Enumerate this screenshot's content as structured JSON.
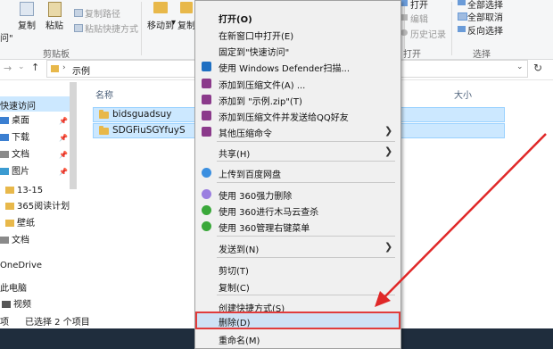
{
  "ribbon": {
    "copy_path": "复制路径",
    "paste_shortcut": "粘贴快捷方式",
    "copy": "复制",
    "paste": "粘贴",
    "left_fragment": "问\"",
    "clipboard_group": "剪贴板",
    "move_to": "移动到",
    "copy_to_frag": "复制",
    "open": "打开",
    "edit": "编辑",
    "history": "历史记录",
    "open_group": "打开",
    "select_all": "全部选择",
    "select_none": "全部取消",
    "invert": "反向选择",
    "select_group": "选择"
  },
  "address": {
    "path": "示例"
  },
  "columns": {
    "name": "名称",
    "size": "大小"
  },
  "nav": {
    "quick_access": "快速访问",
    "items": [
      {
        "label": "桌面",
        "pinned": true
      },
      {
        "label": "下载",
        "pinned": true
      },
      {
        "label": "文档",
        "pinned": true
      },
      {
        "label": "图片",
        "pinned": true
      },
      {
        "label": "13-15",
        "pinned": false
      },
      {
        "label": "365阅读计划",
        "pinned": false
      },
      {
        "label": "壁纸",
        "pinned": false
      },
      {
        "label": "文档",
        "pinned": false
      }
    ],
    "onedrive": "OneDrive",
    "this_pc": "此电脑",
    "videos": "视频",
    "pin_glyph": "📌"
  },
  "files": [
    {
      "name": "bidsguadsuy"
    },
    {
      "name": "SDGFiuSGYfuyS"
    }
  ],
  "status": {
    "count": "项",
    "selected": "已选择 2 个项目"
  },
  "menu": {
    "items": [
      {
        "label": "打开(O)",
        "bold": true
      },
      {
        "label": "在新窗口中打开(E)"
      },
      {
        "label": "固定到\"快速访问\""
      },
      {
        "label": "使用 Windows Defender扫描...",
        "icon": "defender-shield-icon",
        "color": "#1e6fc2"
      },
      {
        "label": "添加到压缩文件(A) ...",
        "icon": "winrar-archive-icon",
        "color": "#8b3a8b"
      },
      {
        "label": "添加到 \"示例.zip\"(T)",
        "icon": "winrar-archive-icon",
        "color": "#8b3a8b"
      },
      {
        "label": "添加到压缩文件并发送给QQ好友",
        "icon": "winrar-archive-icon",
        "color": "#8b3a8b"
      },
      {
        "label": "其他压缩命令",
        "icon": "winrar-archive-icon",
        "color": "#8b3a8b",
        "submenu": true
      },
      {
        "label": "共享(H)",
        "submenu": true
      },
      {
        "label": "上传到百度网盘",
        "icon": "baidu-cloud-icon",
        "color": "#3b8fe0"
      },
      {
        "label": "使用 360强力删除",
        "icon": "360-delete-icon",
        "color": "#9b7fe0"
      },
      {
        "label": "使用 360进行木马云查杀",
        "icon": "360-scan-icon",
        "color": "#3aa83a"
      },
      {
        "label": "使用 360管理右键菜单",
        "icon": "360-menu-icon",
        "color": "#3aa83a"
      },
      {
        "label": "发送到(N)",
        "submenu": true
      },
      {
        "label": "剪切(T)"
      },
      {
        "label": "复制(C)"
      },
      {
        "label": "创建快捷方式(S)"
      },
      {
        "label": "删除(D)",
        "highlight": true
      },
      {
        "label": "重命名(M)"
      }
    ],
    "submenu_arrow": "❯"
  },
  "colors": {
    "annotation_arrow": "#e02828",
    "highlight_box": "#e03c3c",
    "selection": "#cce8ff"
  }
}
